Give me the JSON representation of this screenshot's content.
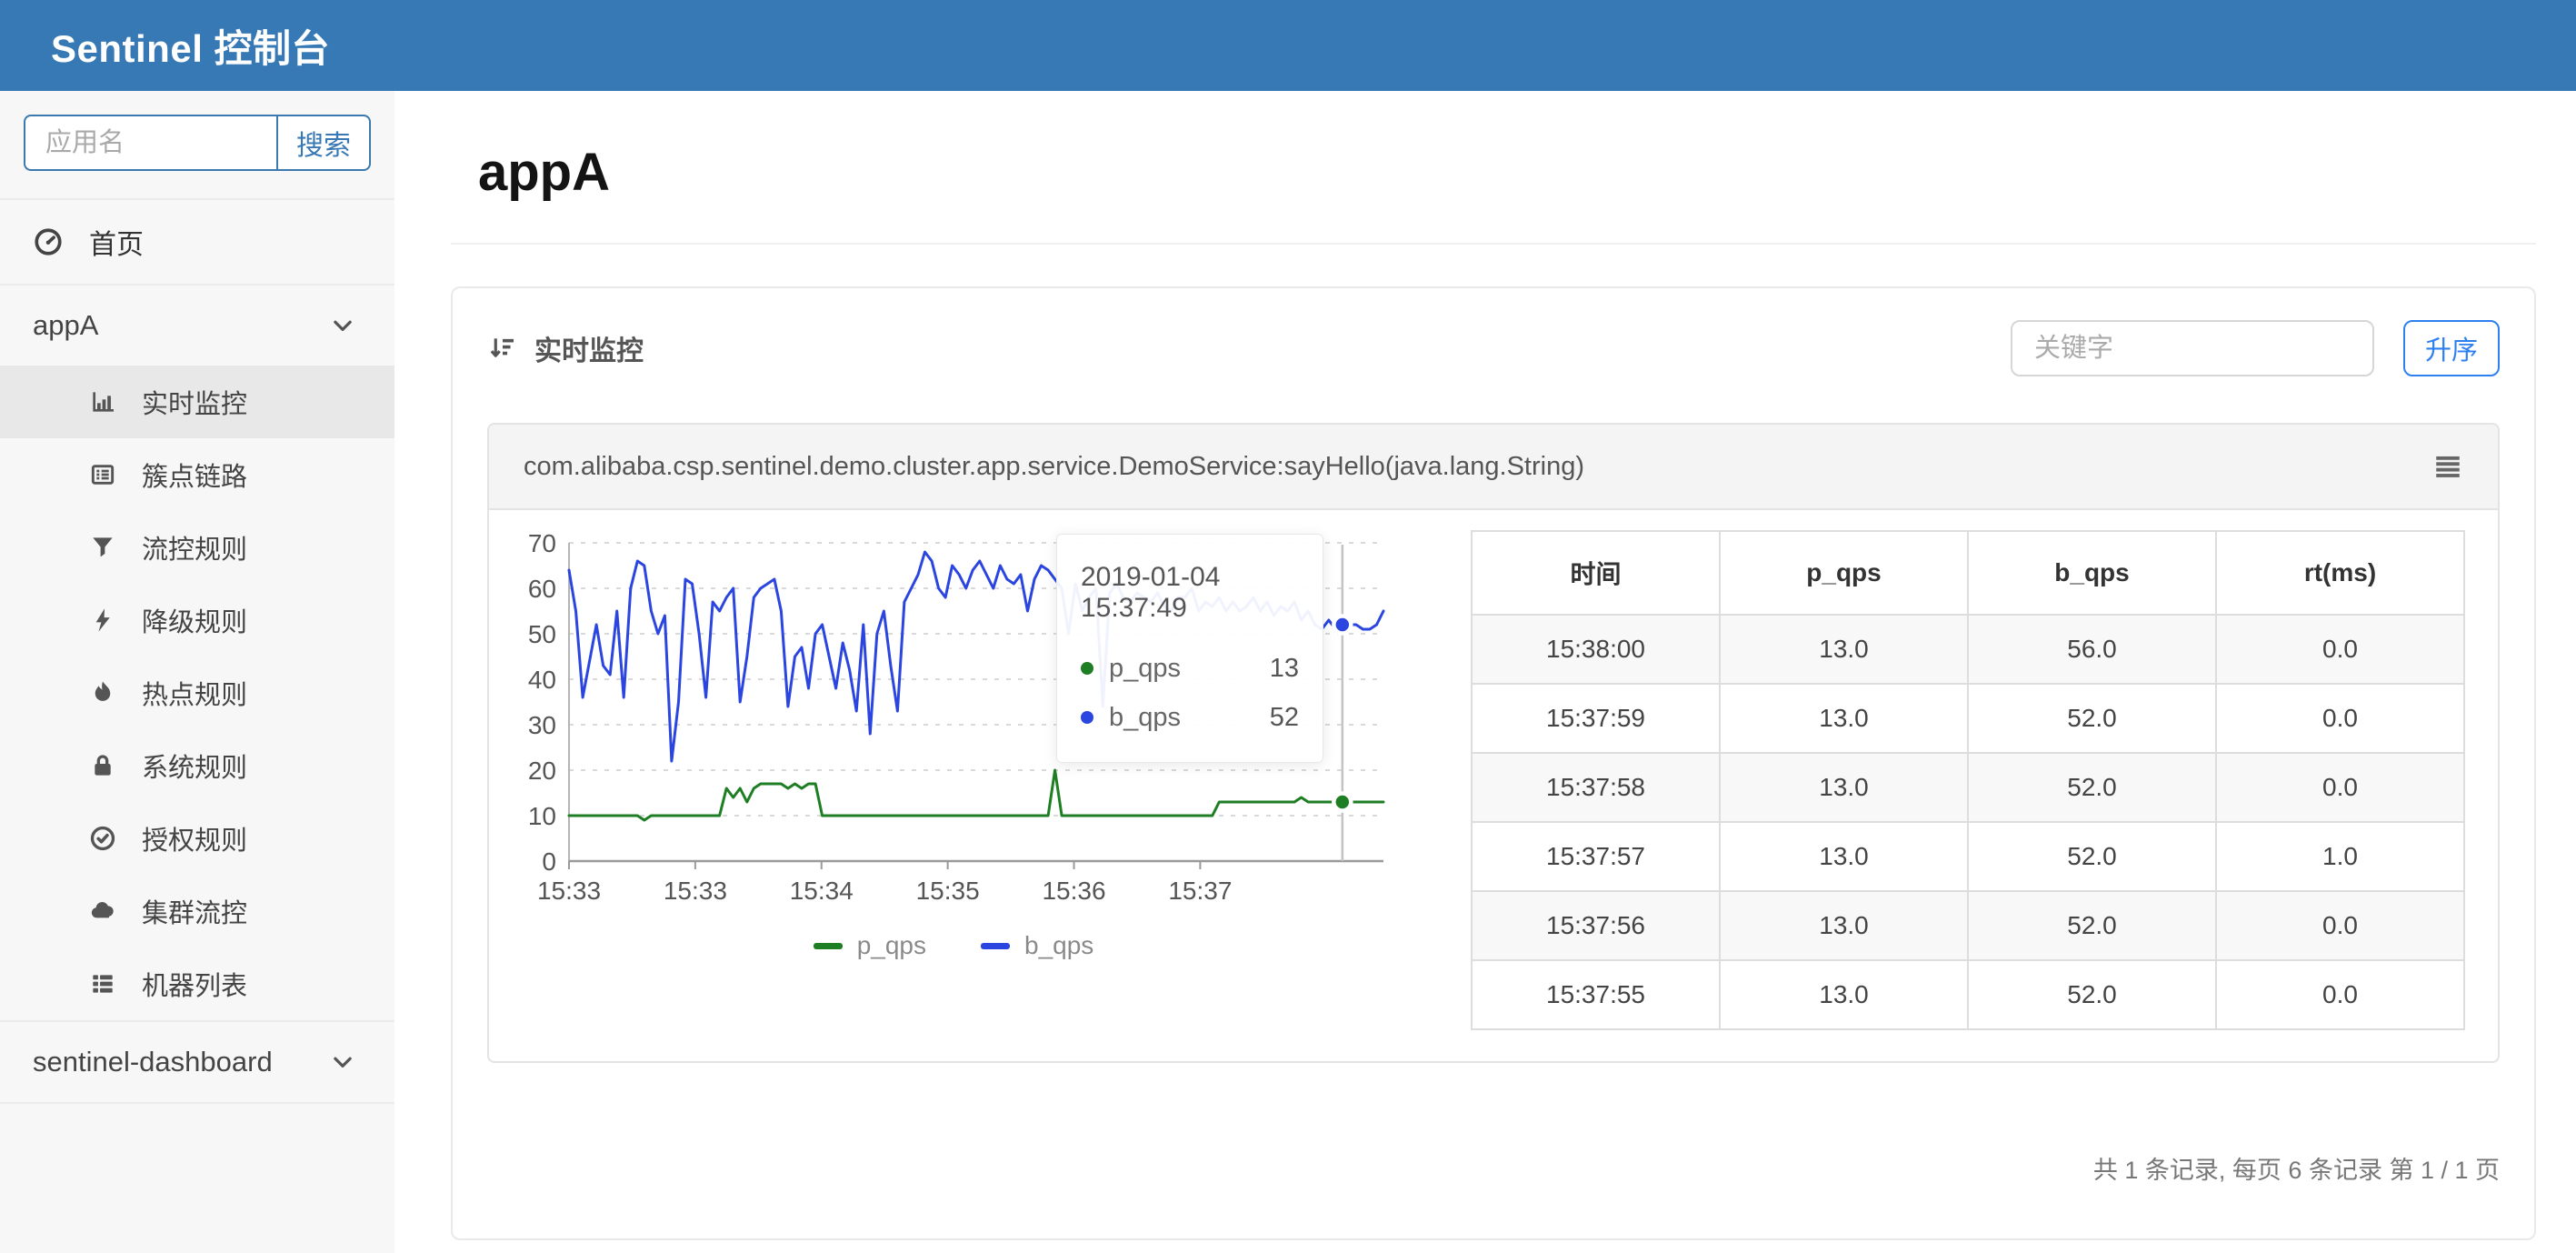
{
  "navbar": {
    "title": "Sentinel 控制台"
  },
  "sidebar": {
    "search": {
      "placeholder": "应用名",
      "button_label": "搜索"
    },
    "home": {
      "label": "首页"
    },
    "app_group": {
      "label": "appA"
    },
    "menu": [
      {
        "label": "实时监控",
        "icon": "bar-chart-icon",
        "active": true
      },
      {
        "label": "簇点链路",
        "icon": "list-alt-icon",
        "active": false
      },
      {
        "label": "流控规则",
        "icon": "filter-icon",
        "active": false
      },
      {
        "label": "降级规则",
        "icon": "bolt-icon",
        "active": false
      },
      {
        "label": "热点规则",
        "icon": "flame-icon",
        "active": false
      },
      {
        "label": "系统规则",
        "icon": "lock-icon",
        "active": false
      },
      {
        "label": "授权规则",
        "icon": "check-circle-icon",
        "active": false
      },
      {
        "label": "集群流控",
        "icon": "cloud-icon",
        "active": false
      },
      {
        "label": "机器列表",
        "icon": "th-list-icon",
        "active": false
      }
    ],
    "dashboard_group": {
      "label": "sentinel-dashboard"
    }
  },
  "main": {
    "page_title": "appA",
    "panel": {
      "title": "实时监控",
      "keyword_placeholder": "关键字",
      "sort_button_label": "升序"
    },
    "resource_name": "com.alibaba.csp.sentinel.demo.cluster.app.service.DemoService:sayHello(java.lang.String)",
    "footer_text": "共 1 条记录, 每页 6 条记录 第 1 / 1 页"
  },
  "tooltip": {
    "timestamp": "2019-01-04 15:37:49",
    "rows": [
      {
        "name": "p_qps",
        "value": "13",
        "color": "#1e7e23"
      },
      {
        "name": "b_qps",
        "value": "52",
        "color": "#2b45e0"
      }
    ]
  },
  "table": {
    "headers": [
      "时间",
      "p_qps",
      "b_qps",
      "rt(ms)"
    ],
    "rows": [
      [
        "15:38:00",
        "13.0",
        "56.0",
        "0.0"
      ],
      [
        "15:37:59",
        "13.0",
        "52.0",
        "0.0"
      ],
      [
        "15:37:58",
        "13.0",
        "52.0",
        "0.0"
      ],
      [
        "15:37:57",
        "13.0",
        "52.0",
        "1.0"
      ],
      [
        "15:37:56",
        "13.0",
        "52.0",
        "0.0"
      ],
      [
        "15:37:55",
        "13.0",
        "52.0",
        "0.0"
      ]
    ]
  },
  "chart_data": {
    "type": "line",
    "title": "",
    "xlabel": "",
    "ylabel": "",
    "ylim": [
      0,
      70
    ],
    "y_ticks": [
      0,
      10,
      20,
      30,
      40,
      50,
      60,
      70
    ],
    "x_tick_labels": [
      "15:33",
      "15:33",
      "15:34",
      "15:35",
      "15:36",
      "15:37"
    ],
    "x_tick_fracs": [
      0,
      0.155,
      0.31,
      0.465,
      0.62,
      0.775
    ],
    "grid": "dashed horizontal",
    "legend_position": "bottom-center",
    "series": [
      {
        "name": "p_qps",
        "color": "#1e7e23",
        "values": [
          10,
          10,
          10,
          10,
          10,
          10,
          10,
          10,
          10,
          10,
          10,
          9,
          10,
          10,
          10,
          10,
          10,
          10,
          10,
          10,
          10,
          10,
          10,
          16,
          14,
          16,
          13,
          16,
          17,
          17,
          17,
          17,
          16,
          17,
          16,
          17,
          17,
          10,
          10,
          10,
          10,
          10,
          10,
          10,
          10,
          10,
          10,
          10,
          10,
          10,
          10,
          10,
          10,
          10,
          10,
          10,
          10,
          10,
          10,
          10,
          10,
          10,
          10,
          10,
          10,
          10,
          10,
          10,
          10,
          10,
          10,
          20,
          10,
          10,
          10,
          10,
          10,
          10,
          10,
          10,
          10,
          10,
          10,
          10,
          10,
          10,
          10,
          10,
          10,
          10,
          10,
          10,
          10,
          10,
          10,
          13,
          13,
          13,
          13,
          13,
          13,
          13,
          13,
          13,
          13,
          13,
          13,
          14,
          13,
          13,
          13,
          13,
          13,
          13,
          13,
          13,
          13,
          13,
          13,
          13
        ]
      },
      {
        "name": "b_qps",
        "color": "#2b45e0",
        "values": [
          64,
          55,
          36,
          44,
          52,
          43,
          41,
          55,
          36,
          60,
          66,
          65,
          55,
          50,
          54,
          22,
          35,
          62,
          61,
          50,
          36,
          57,
          55,
          58,
          60,
          35,
          45,
          58,
          60,
          61,
          62,
          55,
          34,
          45,
          47,
          38,
          50,
          52,
          45,
          38,
          48,
          42,
          33,
          52,
          28,
          50,
          55,
          43,
          33,
          57,
          60,
          63,
          68,
          66,
          60,
          58,
          65,
          63,
          60,
          64,
          66,
          63,
          60,
          65,
          62,
          61,
          63,
          55,
          62,
          65,
          64,
          62,
          60,
          50,
          61,
          55,
          58,
          60,
          34,
          59,
          61,
          58,
          57,
          59,
          58,
          57,
          59,
          56,
          55,
          58,
          58,
          60,
          55,
          57,
          56,
          58,
          55,
          57,
          55,
          56,
          58,
          55,
          57,
          54,
          56,
          55,
          57,
          53,
          55,
          52,
          51,
          53,
          51,
          52,
          52,
          52,
          51,
          51,
          52,
          55
        ]
      }
    ],
    "hover": {
      "index": 113,
      "p_qps": 13,
      "b_qps": 52
    }
  },
  "colors": {
    "navbar_blue": "#3779b5",
    "search_border_blue": "#3b79ae",
    "asc_button_blue": "#2e80f0",
    "chart_green": "#1e7e23",
    "chart_blue": "#2b45e0"
  }
}
